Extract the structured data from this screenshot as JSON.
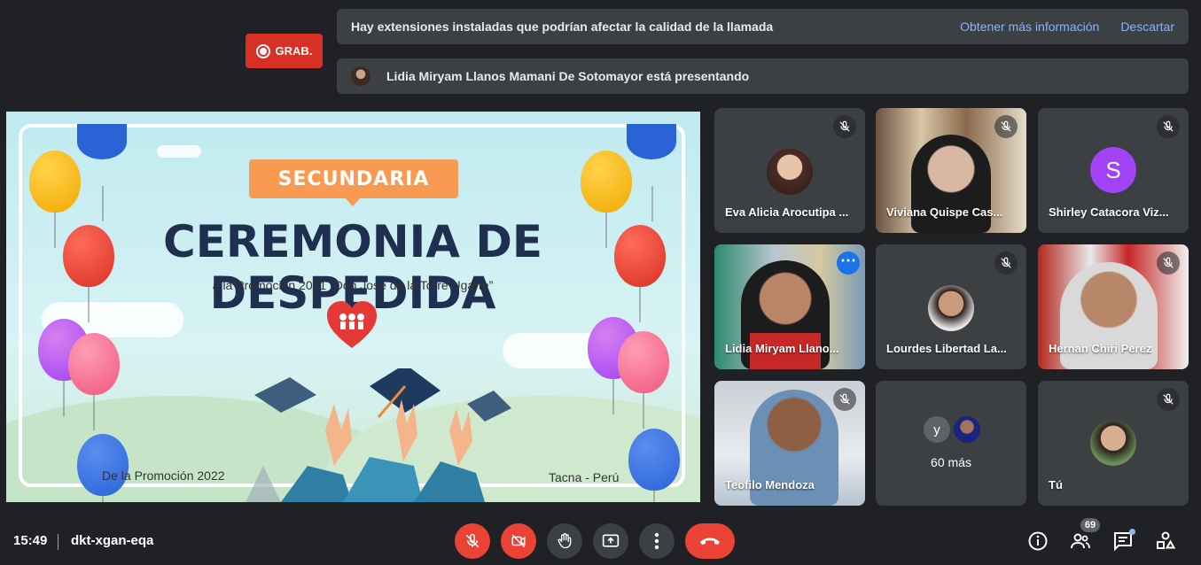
{
  "banner": {
    "message": "Hay extensiones instaladas que podrían afectar la calidad de la llamada",
    "learn_more": "Obtener más información",
    "dismiss": "Descartar"
  },
  "recording": {
    "label": "GRAB."
  },
  "presenting": {
    "text": "Lidia Miryam Llanos Mamani De Sotomayor está presentando"
  },
  "slide": {
    "tag": "SECUNDARIA",
    "title": "CEREMONIA DE DESPEDIDA",
    "subtitle": "a la Promoción 2021 “Don José de la Torre Ugarte”",
    "logo_text": "FE Y ALEGRÍA TACNA",
    "footer_left": "De la Promoción 2022",
    "footer_right": "Tacna - Perú"
  },
  "participants": [
    {
      "name": "Eva Alicia Arocutipa ...",
      "muted": true,
      "type": "avatar-photo"
    },
    {
      "name": "Viviana Quispe Cas...",
      "muted": true,
      "type": "video"
    },
    {
      "name": "Shirley Catacora Viz...",
      "muted": true,
      "type": "letter",
      "letter": "S",
      "color": "#a142f4"
    },
    {
      "name": "Lidia Miryam Llano...",
      "muted": false,
      "type": "video",
      "presenting": true
    },
    {
      "name": "Lourdes Libertad La...",
      "muted": true,
      "type": "avatar-photo"
    },
    {
      "name": "Hernan Chiri Perez",
      "muted": true,
      "type": "video"
    },
    {
      "name": "Teofilo Mendoza",
      "muted": true,
      "type": "video"
    },
    {
      "name": "60 más",
      "type": "overflow",
      "letter": "y"
    },
    {
      "name": "Tú",
      "muted": true,
      "type": "avatar-photo"
    }
  ],
  "bottom_bar": {
    "time": "15:49",
    "meeting_code": "dkt-xgan-eqa",
    "people_count": "69"
  },
  "colors": {
    "background": "#202124",
    "tile": "#3c4043",
    "danger": "#ea4335",
    "link": "#8ab4f8"
  }
}
